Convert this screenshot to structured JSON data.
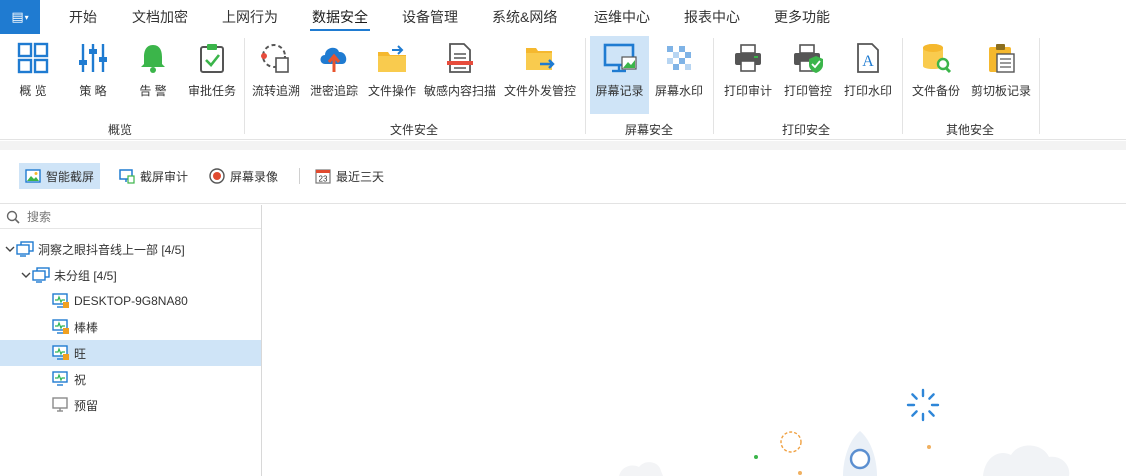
{
  "menubar": {
    "app_menu_glyph": "▤",
    "items": [
      {
        "label": "开始"
      },
      {
        "label": "文档加密"
      },
      {
        "label": "上网行为"
      },
      {
        "label": "数据安全",
        "active": true
      },
      {
        "label": "设备管理"
      },
      {
        "label": "系统&网络"
      },
      {
        "label": "运维中心"
      },
      {
        "label": "报表中心"
      },
      {
        "label": "更多功能"
      }
    ]
  },
  "ribbon": {
    "buttons": [
      {
        "label": "概 览",
        "icon": "grid-icon"
      },
      {
        "label": "策 略",
        "icon": "sliders-icon"
      },
      {
        "label": "告 警",
        "icon": "bell-icon"
      },
      {
        "label": "审批任务",
        "icon": "clipboard-check-icon"
      },
      {
        "label": "流转追溯",
        "icon": "flow-trace-icon"
      },
      {
        "label": "泄密追踪",
        "icon": "cloud-upload-icon"
      },
      {
        "label": "文件操作",
        "icon": "folder-exchange-icon"
      },
      {
        "label": "敏感内容扫描",
        "icon": "document-scan-icon"
      },
      {
        "label": "文件外发管控",
        "icon": "folder-send-icon"
      },
      {
        "label": "屏幕记录",
        "icon": "monitor-picture-icon",
        "active": true
      },
      {
        "label": "屏幕水印",
        "icon": "mosaic-icon"
      },
      {
        "label": "打印审计",
        "icon": "printer-icon"
      },
      {
        "label": "打印管控",
        "icon": "printer-shield-icon"
      },
      {
        "label": "打印水印",
        "icon": "document-a-icon"
      },
      {
        "label": "文件备份",
        "icon": "database-search-icon"
      },
      {
        "label": "剪切板记录",
        "icon": "clipboard-icon"
      }
    ],
    "groups": [
      {
        "label": "概览"
      },
      {
        "label": "文件安全"
      },
      {
        "label": "屏幕安全"
      },
      {
        "label": "打印安全"
      },
      {
        "label": "其他安全"
      }
    ]
  },
  "toolbar": {
    "items": [
      {
        "label": "智能截屏",
        "icon": "image-icon",
        "active": true
      },
      {
        "label": "截屏审计",
        "icon": "monitor-audit-icon"
      },
      {
        "label": "屏幕录像",
        "icon": "record-icon"
      },
      {
        "label": "最近三天",
        "icon": "calendar-icon"
      }
    ],
    "calendar_day": "23"
  },
  "tree": {
    "search_placeholder": "搜索",
    "nodes": [
      {
        "label": "洞察之眼抖音线上一部  [4/5]",
        "level": 0,
        "type": "group",
        "expanded": true
      },
      {
        "label": "未分组  [4/5]",
        "level": 1,
        "type": "group",
        "expanded": true
      },
      {
        "label": "DESKTOP-9G8NA80",
        "level": 2,
        "type": "online-locked"
      },
      {
        "label": "棒棒",
        "level": 2,
        "type": "online-locked"
      },
      {
        "label": "旺",
        "level": 2,
        "type": "online-locked",
        "selected": true
      },
      {
        "label": "祝",
        "level": 2,
        "type": "online"
      },
      {
        "label": "预留",
        "level": 2,
        "type": "offline"
      }
    ]
  },
  "colors": {
    "accent": "#1f7bd1",
    "selected_bg": "#cfe4f7",
    "online_green": "#2fb45a",
    "offline_gray": "#8a8a8a",
    "lock_orange": "#f0a020"
  }
}
